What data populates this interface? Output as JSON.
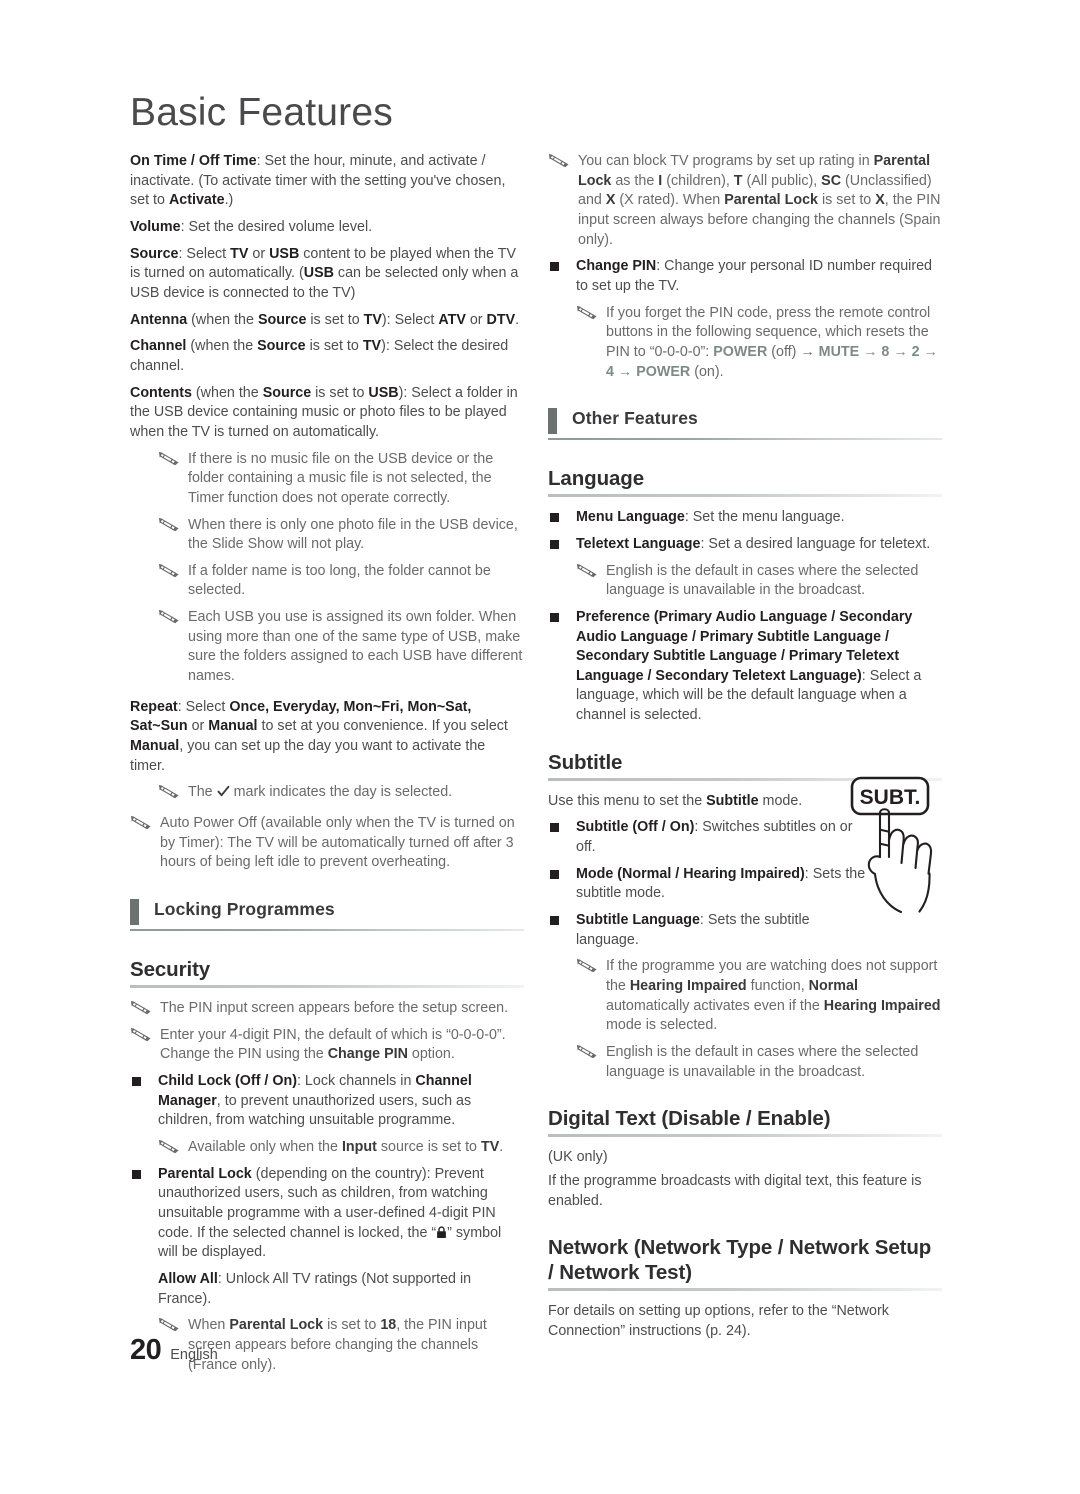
{
  "document": {
    "title": "Basic Features",
    "footer": {
      "page_number": "20",
      "language": "English"
    }
  },
  "icons": {
    "note": "pencil-note-icon",
    "bullet": "square-bullet-icon",
    "lock": "padlock-icon",
    "check": "checkmark-icon",
    "remote_button": "subt-remote-button-icon",
    "hand": "pointing-hand-icon"
  },
  "colors": {
    "section_bar": "#6b7270",
    "heading_text": "#2f2f31",
    "body_text": "#4d4d4f",
    "note_text": "#6a6a6c",
    "bold_text": "#231f20",
    "key_label": "#7d8a86"
  },
  "left_column": {
    "timer_settings": {
      "on_off_time": {
        "label": "On Time / Off Time",
        "text": ": Set the hour, minute, and activate / inactivate. (To activate timer with the setting you've chosen, set to ",
        "bold_tail": "Activate",
        "tail": ".)"
      },
      "volume": {
        "label": "Volume",
        "text": ": Set the desired volume level."
      },
      "source": {
        "label": "Source",
        "p1": ": Select ",
        "b1": "TV",
        "p2": " or ",
        "b2": "USB",
        "p3": " content to be played when the TV is turned on automatically. (",
        "b3": "USB",
        "p4": " can be selected only when a USB device is connected to the TV)"
      },
      "antenna": {
        "label": "Antenna",
        "p1": " (when the ",
        "b1": "Source",
        "p2": " is set to ",
        "b2": "TV",
        "p3": "): Select ",
        "b3": "ATV",
        "p4": " or ",
        "b4": "DTV",
        "p5": "."
      },
      "channel": {
        "label": "Channel",
        "p1": " (when the ",
        "b1": "Source",
        "p2": " is set to ",
        "b2": "TV",
        "p3": "): Select the desired channel."
      },
      "contents": {
        "label": "Contents",
        "p1": " (when the ",
        "b1": "Source",
        "p2": " is set to ",
        "b2": "USB",
        "p3": "): Select a folder in the USB device containing music or photo files to be played when the TV is turned on automatically."
      },
      "notes": [
        "If there is no music file on the USB device or the folder containing a music file is not selected, the Timer function does not operate correctly.",
        "When there is only one photo file in the USB device, the Slide Show will not play.",
        "If a folder name is too long, the folder cannot be selected.",
        "Each USB you use is assigned its own folder. When using more than one of the same type of USB, make sure the folders assigned to each USB have different names."
      ],
      "repeat": {
        "label": "Repeat",
        "p1": ": Select ",
        "b1": "Once, Everyday, Mon~Fri, Mon~Sat, Sat~Sun",
        "p2": " or ",
        "b2": "Manual",
        "p3": " to set at you convenience. If you select ",
        "b3": "Manual",
        "p4": ", you can set up the day you want to activate the timer."
      },
      "repeat_note_pre": "The ",
      "repeat_note_post": " mark indicates the day is selected.",
      "auto_power_off_note": "Auto Power Off (available only when the TV is turned on by Timer): The TV will be automatically turned off after 3 hours of being left idle to prevent overheating."
    },
    "section_locking": {
      "title": "Locking Programmes"
    },
    "security": {
      "heading": "Security",
      "note_1": "The PIN input screen appears before the setup screen.",
      "note_2": {
        "p1": "Enter your 4-digit PIN, the default of which is “0-0-0-0”. Change the PIN using the ",
        "b1": "Change PIN",
        "p2": " option."
      },
      "child_lock": {
        "label": "Child Lock (Off / On)",
        "p1": ": Lock channels in ",
        "b1": "Channel Manager",
        "p2": ", to prevent unauthorized users, such as children, from watching unsuitable programme.",
        "note": {
          "p1": "Available only when the ",
          "b1": "Input",
          "p2": " source is set to ",
          "b2": "TV",
          "p3": "."
        }
      },
      "parental_lock": {
        "label": "Parental Lock",
        "p1": " (depending on the country): Prevent unauthorized users, such as children, from watching unsuitable programme with a user-defined 4-digit PIN code. If the selected channel is locked, the “",
        "p2": "” symbol will be displayed.",
        "allow_all": {
          "label": "Allow All",
          "text": ": Unlock All TV ratings (Not supported in France)."
        },
        "note": {
          "p1": "When ",
          "b1": "Parental Lock",
          "p2": " is set to ",
          "b2": "18",
          "p3": ", the PIN input screen appears before changing the channels (France only)."
        }
      }
    }
  },
  "right_column": {
    "block_tv_note": {
      "p1": "You can block TV programs by set up rating in ",
      "b1": "Parental Lock",
      "p2": " as the ",
      "b2": "I",
      "p3": " (children), ",
      "b3": "T",
      "p4": " (All public), ",
      "b4": "SC",
      "p5": " (Unclassified) and ",
      "b5": "X",
      "p6": " (X rated). When ",
      "b6": "Parental Lock",
      "p7": " is set to ",
      "b7": "X",
      "p8": ", the PIN input screen always before changing the channels (Spain only)."
    },
    "change_pin": {
      "label": "Change PIN",
      "text": ": Change your personal ID number required to set up the TV.",
      "note": {
        "p1": "If you forget the PIN code, press the remote control buttons in the following sequence, which resets the PIN to “0-0-0-0”: ",
        "k1": "POWER",
        "p2": " (off) → ",
        "k2": "MUTE",
        "p3": " → 8 → 2 → 4 → ",
        "k3": "POWER",
        "p4": " (on)."
      }
    },
    "section_other": {
      "title": "Other Features"
    },
    "language": {
      "heading": "Language",
      "menu_language": {
        "label": "Menu Language",
        "text": ": Set the menu language."
      },
      "teletext_language": {
        "label": "Teletext Language",
        "text": ": Set a desired language for teletext."
      },
      "teletext_note": "English is the default in cases where the selected language is unavailable in the broadcast.",
      "preference": {
        "label": "Preference (Primary Audio Language / Secondary Audio Language / Primary Subtitle Language / Secondary Subtitle Language / Primary Teletext Language / Secondary Teletext Language)",
        "text": ": Select a language, which will be the default language when a channel is selected."
      }
    },
    "subtitle": {
      "heading": "Subtitle",
      "intro": {
        "p1": "Use this menu to set the ",
        "b1": "Subtitle",
        "p2": " mode."
      },
      "subtitle_toggle": {
        "label": "Subtitle (Off / On)",
        "text": ": Switches subtitles on or off."
      },
      "mode": {
        "label": "Mode (Normal / Hearing Impaired)",
        "text": ": Sets the subtitle mode."
      },
      "subtitle_language": {
        "label": "Subtitle Language",
        "text": ": Sets the subtitle language."
      },
      "note_1": {
        "p1": "If the programme you are watching does not support the ",
        "b1": "Hearing Impaired",
        "p2": " function, ",
        "b2": "Normal",
        "p3": " automatically activates even if the ",
        "b3": "Hearing Impaired",
        "p4": " mode is selected."
      },
      "note_2": "English is the default in cases where the selected language is unavailable in the broadcast.",
      "remote_button_label": "SUBT."
    },
    "digital_text": {
      "heading": "Digital Text (Disable / Enable)",
      "uk_only": "(UK only)",
      "text": "If the programme broadcasts with digital text, this feature is enabled."
    },
    "network": {
      "heading": "Network (Network Type / Network Setup / Network Test)",
      "text": "For details on setting up options, refer to the “Network Connection” instructions (p. 24)."
    }
  }
}
